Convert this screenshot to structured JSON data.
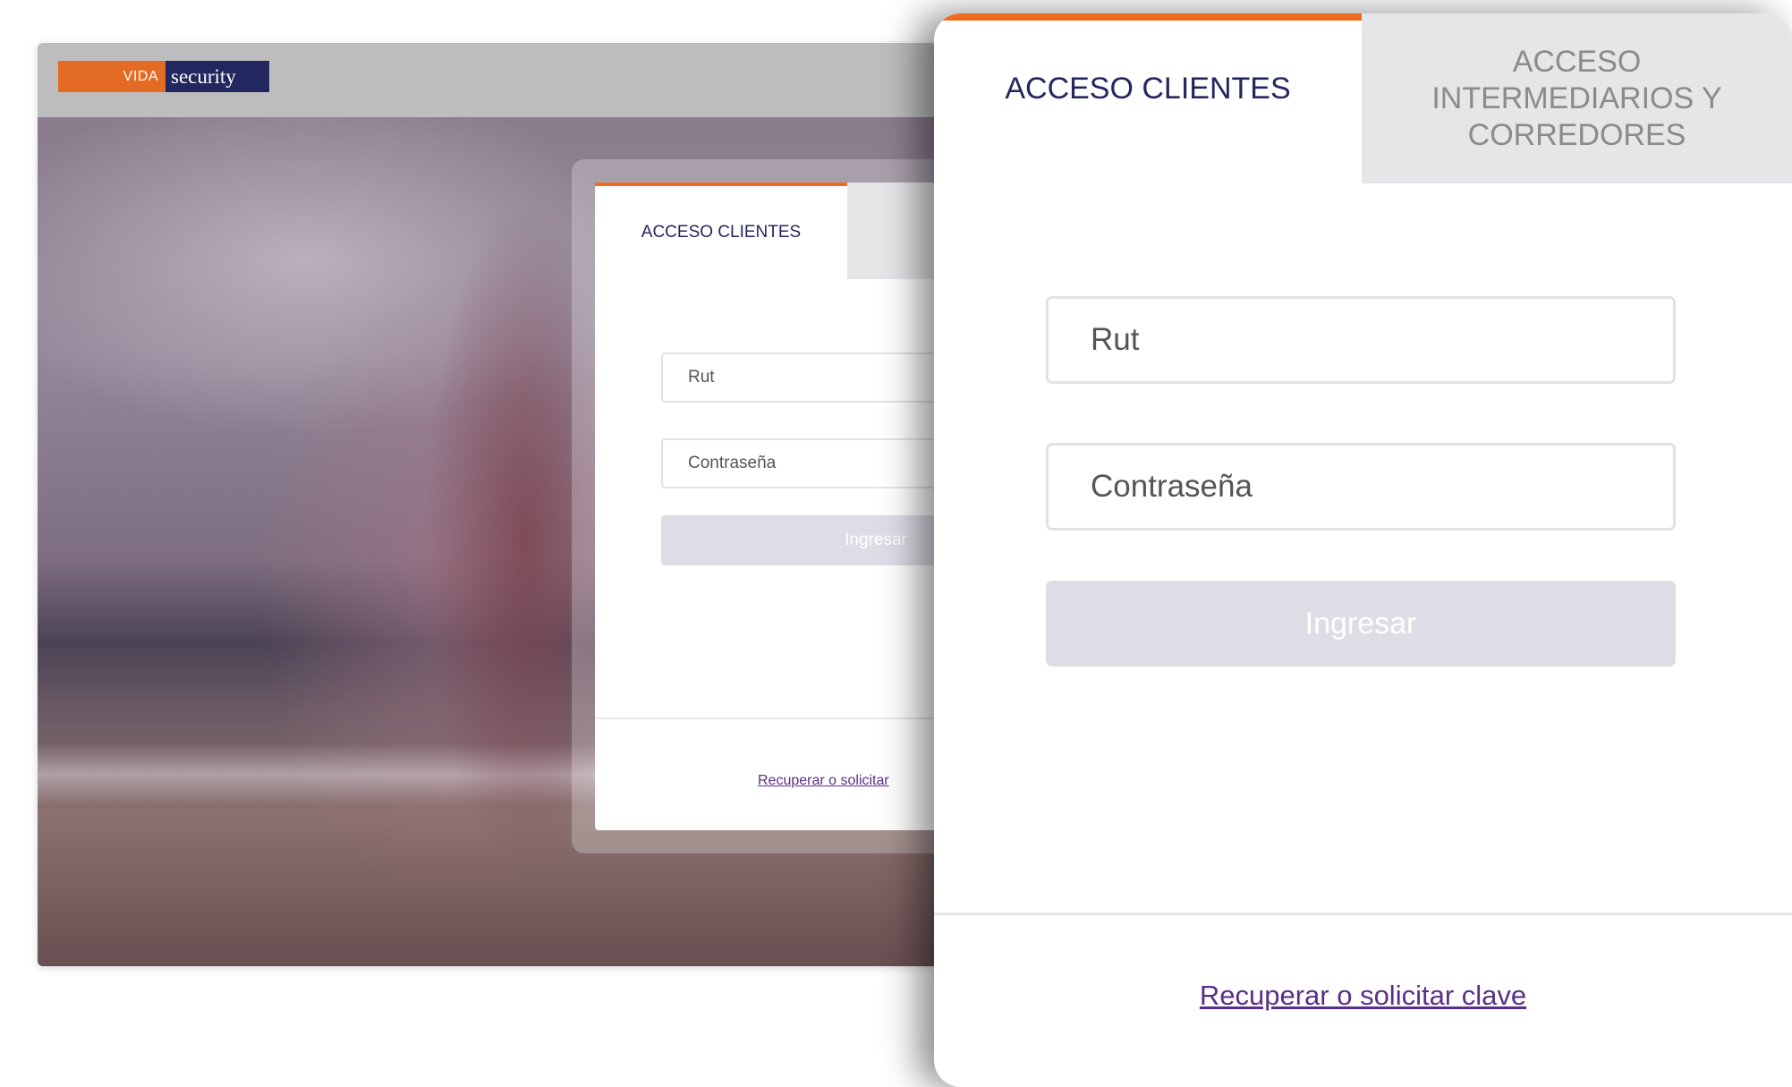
{
  "brand": {
    "logo_left": "VIDA",
    "logo_right": "security",
    "accent": "#ef6a22",
    "navy": "#23275f"
  },
  "login": {
    "tab_clients": "ACCESO CLIENTES",
    "tab_brokers": "ACCESO INTERMEDIARIOS Y CORREDORES",
    "rut_placeholder": "Rut",
    "password_placeholder": "Contraseña",
    "submit_label": "Ingresar",
    "recover_link": "Recuperar o solicitar clave"
  },
  "preview": {
    "tab_clients": "ACCESO CLIENTES",
    "rut_placeholder": "Rut",
    "password_placeholder": "Contraseña",
    "submit_label": "Ingresar",
    "recover_link": "Recuperar o solicitar"
  }
}
